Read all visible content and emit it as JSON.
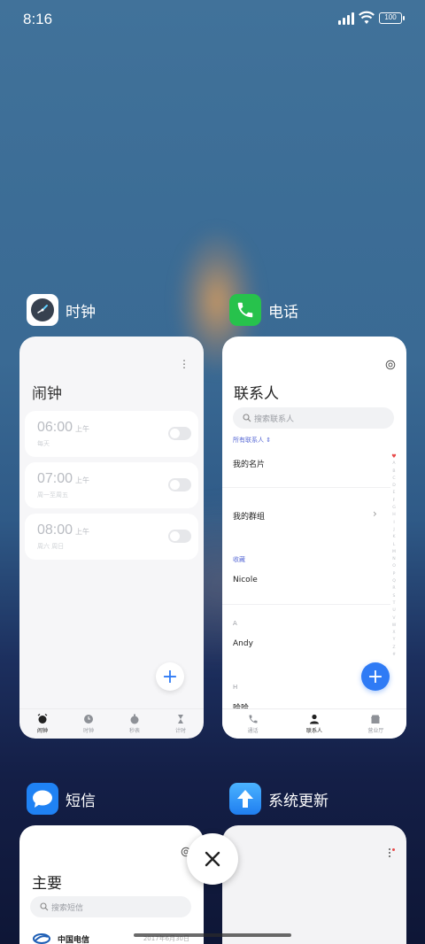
{
  "status_bar": {
    "time": "8:16",
    "battery": "100"
  },
  "cards": {
    "clock": {
      "app_name": "时钟",
      "title": "闹钟",
      "alarms": [
        {
          "time": "06:00",
          "ampm": "上午",
          "repeat": "每天"
        },
        {
          "time": "07:00",
          "ampm": "上午",
          "repeat": "周一至周五"
        },
        {
          "time": "08:00",
          "ampm": "上午",
          "repeat": "周六 周日"
        }
      ],
      "tabs": [
        "闹钟",
        "时钟",
        "秒表",
        "计时"
      ]
    },
    "phone": {
      "app_name": "电话",
      "title": "联系人",
      "search_placeholder": "搜索联系人",
      "filter": "所有联系人",
      "my_card": "我的名片",
      "my_groups": "我的群组",
      "section_favorites": "收藏",
      "contact_1": "Nicole",
      "section_a": "A",
      "contact_2": "Andy",
      "section_h": "H",
      "contact_3": "哈哈",
      "alphabet": [
        "A",
        "B",
        "C",
        "D",
        "E",
        "F",
        "G",
        "H",
        "I",
        "J",
        "K",
        "L",
        "M",
        "N",
        "O",
        "P",
        "Q",
        "R",
        "S",
        "T",
        "U",
        "V",
        "W",
        "X",
        "Y",
        "Z",
        "#"
      ],
      "tabs": [
        "通话",
        "联系人",
        "营业厅"
      ]
    },
    "sms": {
      "app_name": "短信",
      "title": "主要",
      "search_placeholder": "搜索短信",
      "first_sender": "中国电信",
      "first_date": "2017年6月30日"
    },
    "update": {
      "app_name": "系统更新"
    }
  },
  "colors": {
    "accent": "#2f7bf5",
    "phone_green": "#27c24c",
    "sms_blue": "#1f82f4"
  }
}
